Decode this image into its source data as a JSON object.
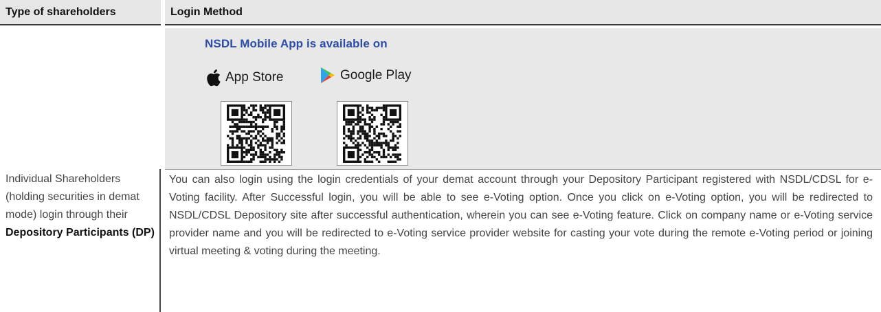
{
  "header": {
    "col1": "Type of shareholders",
    "col2": "Login Method"
  },
  "app_panel": {
    "title": "NSDL Mobile App is available on",
    "stores": [
      {
        "label": "App Store",
        "icon": "apple-icon"
      },
      {
        "label": "Google Play",
        "icon": "google-play-icon"
      }
    ]
  },
  "row": {
    "type_plain": "Individual Shareholders (holding securities in demat mode) login through their",
    "type_bold": "Depository Participants (DP)",
    "method": "You can also login using the login credentials of your demat account through your Depository Participant registered with NSDL/CDSL for e-Voting facility.  After Successful login, you will be able to see e-Voting option. Once you click on e-Voting option, you will be redirected to NSDL/CDSL Depository site after successful authentication, wherein you can see e-Voting feature. Click on company name or e-Voting service provider name and you will be redirected to e-Voting service provider website for casting your vote during the remote e-Voting period or joining virtual meeting & voting during the meeting."
  }
}
